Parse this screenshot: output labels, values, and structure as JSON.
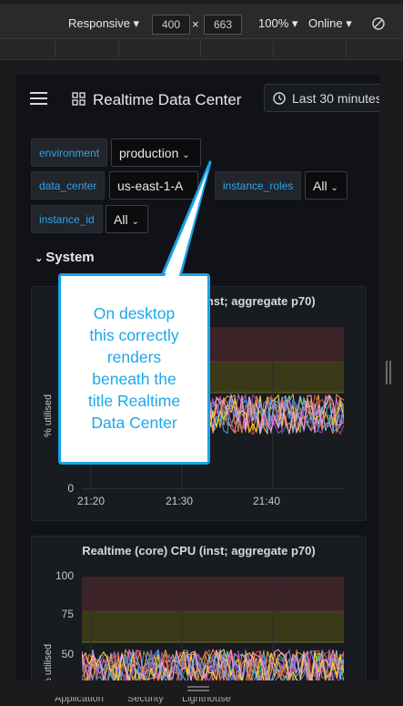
{
  "devtools": {
    "device_label": "Responsive ▾",
    "width_value": "400",
    "times": "×",
    "height_value": "663",
    "zoom_label": "100% ▾",
    "network_label": "Online ▾",
    "bottom_tabs": [
      "Application",
      "Security",
      "Lighthouse"
    ]
  },
  "header": {
    "title": "Realtime Data Center",
    "time_range": "Last 30 minutes"
  },
  "variables": [
    {
      "label": "environment",
      "value": "production"
    },
    {
      "label": "data_center",
      "value": "us-east-1-A"
    },
    {
      "label": "instance_roles",
      "value": "All"
    },
    {
      "label": "instance_id",
      "value": "All"
    }
  ],
  "row_title": "System",
  "panels": [
    {
      "title": "Realtime (core) CPU (inst; aggregate p70)",
      "ylabel": "% utilised",
      "y_ticks": [
        "0"
      ],
      "x_ticks": [
        "21:20",
        "21:30",
        "21:40"
      ]
    },
    {
      "title": "Realtime (core) CPU (inst; aggregate p70)",
      "ylabel": "% utilised",
      "y_ticks": [
        "100",
        "75",
        "50"
      ],
      "x_ticks": []
    }
  ],
  "callout": {
    "lines": [
      "On desktop",
      "this correctly",
      "renders",
      "beneath the",
      "title Realtime",
      "Data Center"
    ]
  },
  "colors": {
    "accent_blue": "#33a2e5",
    "callout_border": "#1aa3e8",
    "threshold_red": "#3b2328",
    "threshold_yellow": "#3a3a18"
  }
}
